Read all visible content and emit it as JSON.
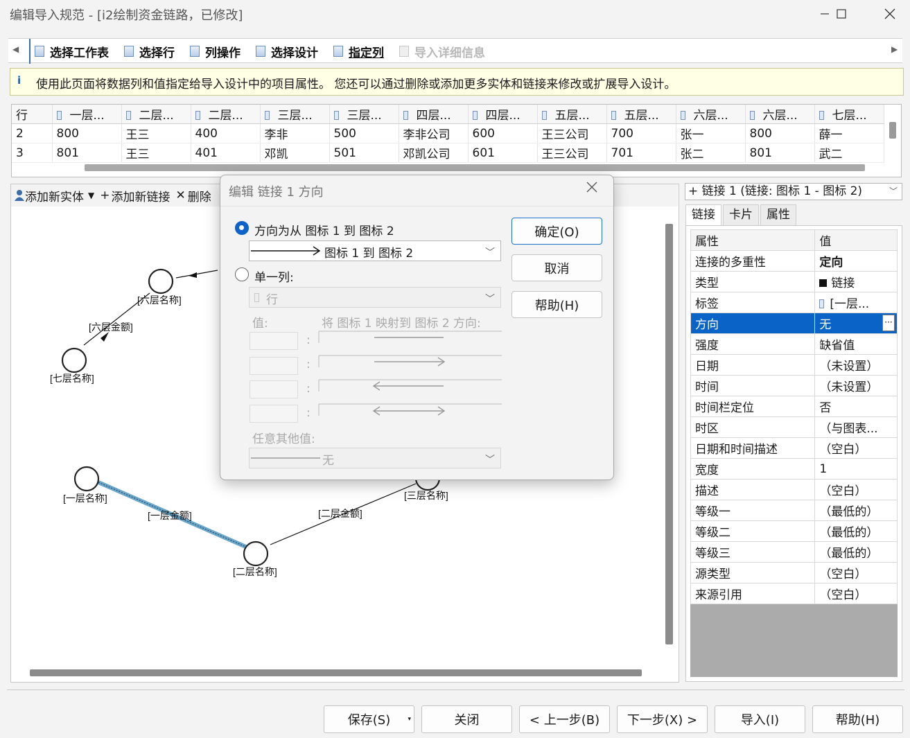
{
  "window": {
    "title": "编辑导入规范 - [i2绘制资金链路，已修改]"
  },
  "steps": [
    {
      "label": "选择工作表",
      "state": "normal"
    },
    {
      "label": "选择行",
      "state": "normal"
    },
    {
      "label": "列操作",
      "state": "normal"
    },
    {
      "label": "选择设计",
      "state": "normal"
    },
    {
      "label": "指定列",
      "state": "active"
    },
    {
      "label": "导入详细信息",
      "state": "disabled"
    }
  ],
  "info": {
    "text": "使用此页面将数据列和值指定给导入设计中的项目属性。 您还可以通过删除或添加更多实体和链接来修改或扩展导入设计。"
  },
  "grid": {
    "row_header": "行",
    "columns": [
      "一层...",
      "二层...",
      "二层...",
      "三层...",
      "三层...",
      "四层...",
      "四层...",
      "五层...",
      "五层...",
      "六层...",
      "六层...",
      "七层..."
    ],
    "rows": [
      {
        "num": "2",
        "cells": [
          "800",
          "王三",
          "400",
          "李非",
          "500",
          "李非公司",
          "600",
          "王三公司",
          "700",
          "张一",
          "800",
          "薛一"
        ]
      },
      {
        "num": "3",
        "cells": [
          "801",
          "王三",
          "401",
          "邓凯",
          "501",
          "邓凯公司",
          "601",
          "王三公司",
          "701",
          "张二",
          "801",
          "武二"
        ]
      }
    ]
  },
  "canvas_toolbar": {
    "add_entity": "添加新实体",
    "add_link": "添加新链接",
    "delete": "删除"
  },
  "canvas": {
    "nodes": {
      "layer1": "[一层名称]",
      "layer2": "[二层名称]",
      "layer3": "[三层名称]",
      "layer6": "[六层名称]",
      "layer7": "[七层名称]"
    },
    "links": {
      "amount1": "[一层金额]",
      "amount2": "[二层金额]",
      "amount6": "[六层金额]"
    }
  },
  "right_panel": {
    "link_selector": "链接 1 (链接: 图标 1 - 图标 2)",
    "tabs": [
      "链接",
      "卡片",
      "属性"
    ],
    "prop_header": {
      "name": "属性",
      "value": "值"
    },
    "properties": [
      {
        "name": "连接的多重性",
        "value": "定向"
      },
      {
        "name": "类型",
        "value": "链接"
      },
      {
        "name": "标签",
        "value": "[一层..."
      },
      {
        "name": "方向",
        "value": "无"
      },
      {
        "name": "强度",
        "value": "缺省值"
      },
      {
        "name": "日期",
        "value": "（未设置）"
      },
      {
        "name": "时间",
        "value": "（未设置）"
      },
      {
        "name": "时间栏定位",
        "value": "否"
      },
      {
        "name": "时区",
        "value": "（与图表..."
      },
      {
        "name": "日期和时间描述",
        "value": "（空白）"
      },
      {
        "name": "宽度",
        "value": "1"
      },
      {
        "name": "描述",
        "value": "（空白）"
      },
      {
        "name": "等级一",
        "value": "（最低的）"
      },
      {
        "name": "等级二",
        "value": "（最低的）"
      },
      {
        "name": "等级三",
        "value": "（最低的）"
      },
      {
        "name": "源类型",
        "value": "（空白）"
      },
      {
        "name": "来源引用",
        "value": "（空白）"
      }
    ]
  },
  "bottom_buttons": {
    "save": "保存(S)",
    "close": "关闭",
    "prev": "< 上一步(B)",
    "next": "下一步(X) >",
    "import": "导入(I)",
    "help": "帮助(H)"
  },
  "dialog": {
    "title": "编辑 链接 1 方向",
    "option1_label": "方向为从 图标 1 到 图标 2",
    "option1_combo": "图标 1 到 图标 2",
    "option2_label": "单一列:",
    "option2_combo": "行",
    "value_label": "值:",
    "map_label": "将 图标 1 映射到 图标 2 方向:",
    "colon": ":",
    "other_label": "任意其他值:",
    "other_combo": "无",
    "ok": "确定(O)",
    "cancel": "取消",
    "help": "帮助(H)"
  },
  "colors": {
    "accent": "#0a64c8",
    "info_bg": "#ffffe6",
    "selected_link": "#6aa6c9"
  }
}
